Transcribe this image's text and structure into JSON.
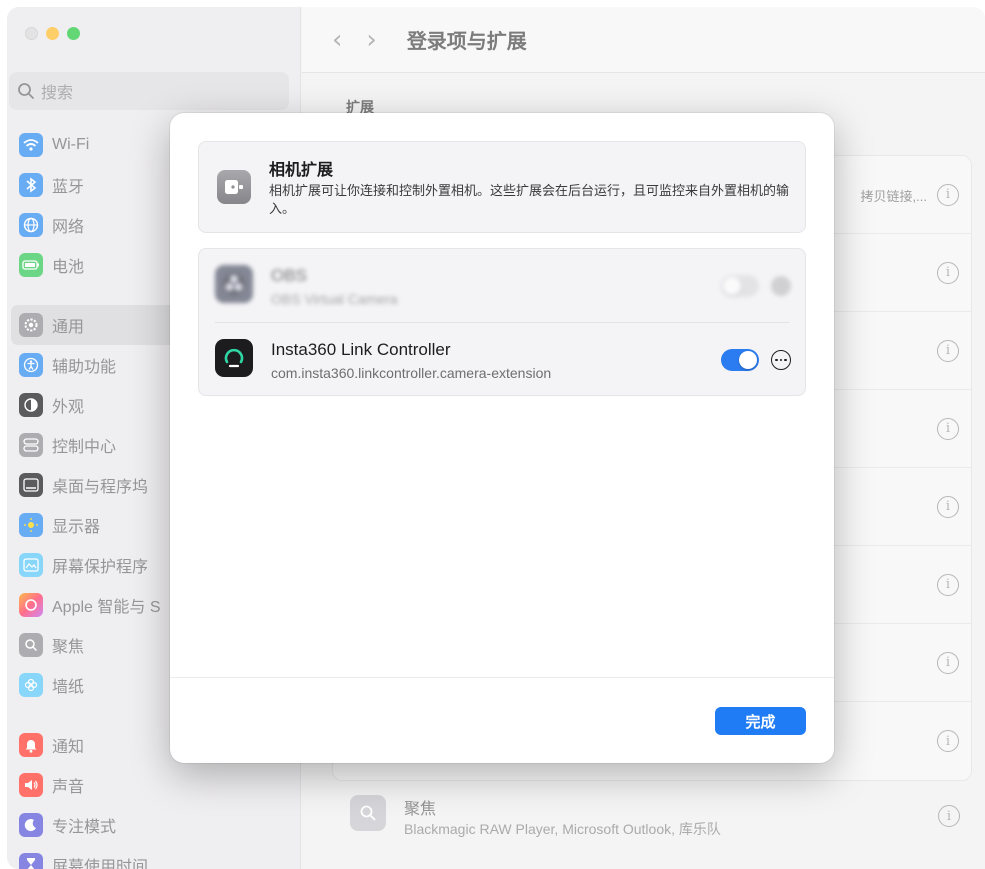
{
  "window": {
    "title": "登录项与扩展"
  },
  "sidebar": {
    "search_placeholder": "搜索",
    "items": [
      {
        "label": "Wi-Fi",
        "icon": "wifi-icon",
        "color": "#2f8cf0"
      },
      {
        "label": "蓝牙",
        "icon": "bluetooth-icon",
        "color": "#2f8cf0"
      },
      {
        "label": "网络",
        "icon": "globe-icon",
        "color": "#2f8cf0"
      },
      {
        "label": "电池",
        "icon": "battery-icon",
        "color": "#34c759"
      },
      {
        "label": "通用",
        "icon": "gear-icon",
        "color": "#8e8e93"
      },
      {
        "label": "辅助功能",
        "icon": "accessibility-icon",
        "color": "#2f8cf0"
      },
      {
        "label": "外观",
        "icon": "appearance-icon",
        "color": "#1d1d1f"
      },
      {
        "label": "控制中心",
        "icon": "control-center-icon",
        "color": "#8e8e93"
      },
      {
        "label": "桌面与程序坞",
        "icon": "dock-icon",
        "color": "#1d1d1f"
      },
      {
        "label": "显示器",
        "icon": "display-icon",
        "color": "#2f8cf0"
      },
      {
        "label": "屏幕保护程序",
        "icon": "screensaver-icon",
        "color": "#5ac8fa"
      },
      {
        "label": "Apple 智能与 S",
        "icon": "apple-intelligence-icon",
        "color": "#ff9f0a"
      },
      {
        "label": "聚焦",
        "icon": "spotlight-icon",
        "color": "#8e8e93"
      },
      {
        "label": "墙纸",
        "icon": "wallpaper-icon",
        "color": "#5ac8fa"
      },
      {
        "label": "通知",
        "icon": "notification-icon",
        "color": "#ff3b30"
      },
      {
        "label": "声音",
        "icon": "sound-icon",
        "color": "#ff3b30"
      },
      {
        "label": "专注模式",
        "icon": "focus-moon-icon",
        "color": "#5856d6"
      },
      {
        "label": "屏幕使用时间",
        "icon": "hourglass-icon",
        "color": "#5856d6"
      }
    ]
  },
  "main": {
    "section_header": "扩展",
    "row_subtext": "拷贝链接,...",
    "focus_row": {
      "title": "聚焦",
      "subtitle": "Blackmagic RAW Player, Microsoft Outlook, 库乐队"
    }
  },
  "modal": {
    "category": {
      "title": "相机扩展",
      "description": "相机扩展可让你连接和控制外置相机。这些扩展会在后台运行，且可监控来自外置相机的输入。"
    },
    "extensions": [
      {
        "name": "OBS",
        "subtitle": "OBS Virtual Camera",
        "enabled": false
      },
      {
        "name": "Insta360 Link Controller",
        "subtitle": "com.insta360.linkcontroller.camera-extension",
        "enabled": true
      }
    ],
    "done_label": "完成",
    "accent_color": "#1f7cf4"
  }
}
